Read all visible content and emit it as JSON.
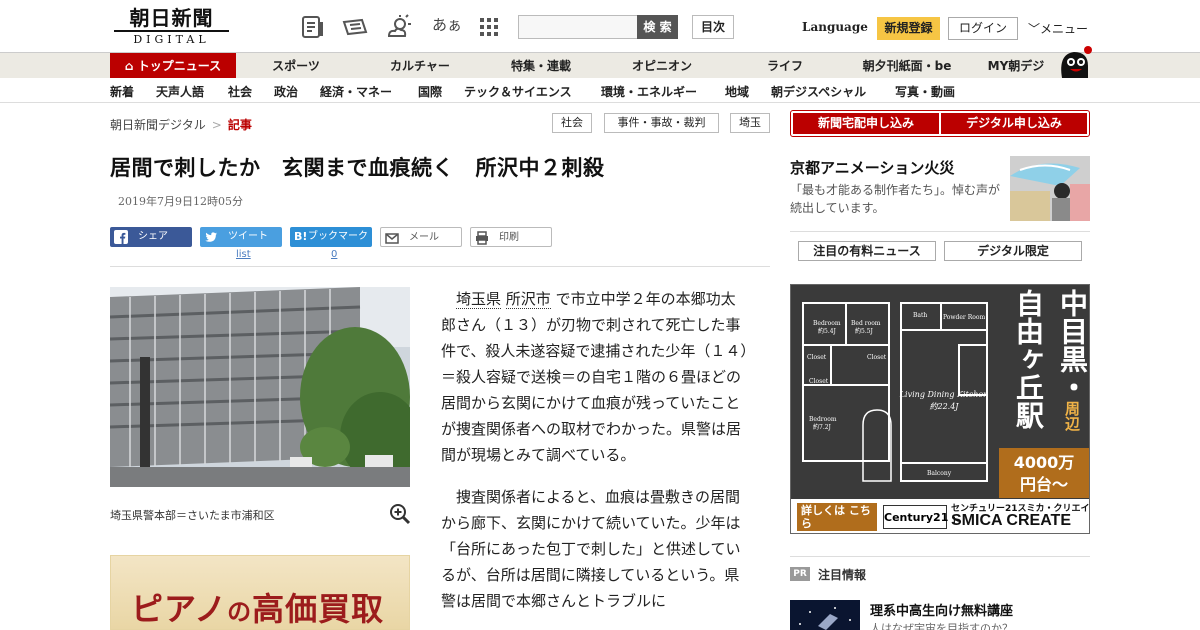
{
  "header": {
    "logo_jp": "朝日新聞",
    "logo_en": "DIGITAL",
    "search_button": "検 索",
    "toc_button": "目次",
    "language": "Language",
    "register": "新規登録",
    "login": "ログイン",
    "menu": "メニュー",
    "font_size_icon_text": "あぁ"
  },
  "nav_primary": [
    "トップニュース",
    "スポーツ",
    "カルチャー",
    "特集・連載",
    "オピニオン",
    "ライフ",
    "朝夕刊紙面・be",
    "MY朝デジ"
  ],
  "nav_secondary": [
    "新着",
    "天声人語",
    "社会",
    "政治",
    "経済・マネー",
    "国際",
    "テック＆サイエンス",
    "環境・エネルギー",
    "地域",
    "朝デジスペシャル",
    "写真・動画"
  ],
  "breadcrumb": {
    "home": "朝日新聞デジタル",
    "sep": ">",
    "current": "記事"
  },
  "tags": [
    "社会",
    "事件・事故・裁判",
    "埼玉"
  ],
  "article": {
    "headline": "居間で刺したか　玄関まで血痕続く　所沢中２刺殺",
    "date": "2019年7月9日12時05分",
    "share": {
      "facebook": "シェア",
      "twitter": "ツイート",
      "twitter_sub": "list",
      "hatena": "ブックマーク",
      "hatena_sub": "0",
      "mail": "メール",
      "print": "印刷"
    },
    "photo_caption": "埼玉県警本部＝さいたま市浦和区",
    "para1_link1": "埼玉県",
    "para1_link2": "所沢市",
    "para1_rest": "で市立中学２年の本郷功太郎さん（１３）が刃物で刺されて死亡した事件で、殺人未遂容疑で逮捕された少年（１４）＝殺人容疑で送検＝の自宅１階の６畳ほどの居間から玄関にかけて血痕が残っていたことが捜査関係者への取材でわかった。県警は居間が現場とみて調べている。",
    "para2": "捜査関係者によると、血痕は畳敷きの居間から廊下、玄関にかけて続いていた。少年は「台所にあった包丁で刺した」と供述しているが、台所は居間に隣接しているという。県警は居間で本郷さんとトラブルに"
  },
  "ad_left": {
    "text_a": "ピアノ",
    "text_b": "の",
    "text_c": "高価買取"
  },
  "right": {
    "btn_delivery": "新聞宅配申し込み",
    "btn_digital": "デジタル申し込み",
    "feature_title": "京都アニメーション火災",
    "feature_desc": "「最も才能ある制作者たち」。悼む声が続出しています。",
    "tab1": "注目の有料ニュース",
    "tab2": "デジタル限定",
    "pr_badge": "PR",
    "pr_title": "注目情報",
    "pr_head": "理系中高生向け無料講座",
    "pr_sub": "人はなぜ宇宙を目指すのか？"
  },
  "ad_right": {
    "col1": "自由ヶ丘駅",
    "col2_a": "中目黒・",
    "col2_b": "周辺",
    "price_a": "4000万",
    "price_b": "円台〜",
    "more": "詳しくは こちら",
    "century": "Century21",
    "brand_small": "センチュリー21スミカ・クリエイト",
    "brand_big": "SMICA CREATE",
    "room_bed1": "Bedroom",
    "room_bed1_size": "約5.4J",
    "room_bed2": "Bed room",
    "room_bed2_size": "約5.5J",
    "room_bed3": "Bedroom",
    "room_bed3_size": "約7.2J",
    "room_living": "Living Dining Kitchen",
    "room_living_size": "約22.4J",
    "room_closet": "Closet",
    "room_bath": "Bath",
    "room_powder": "Powder Room",
    "room_balcony": "Balcony"
  },
  "colors": {
    "brand_red": "#bb0000",
    "accent_yellow": "#f6c544",
    "nav_bg": "#eceae3"
  }
}
